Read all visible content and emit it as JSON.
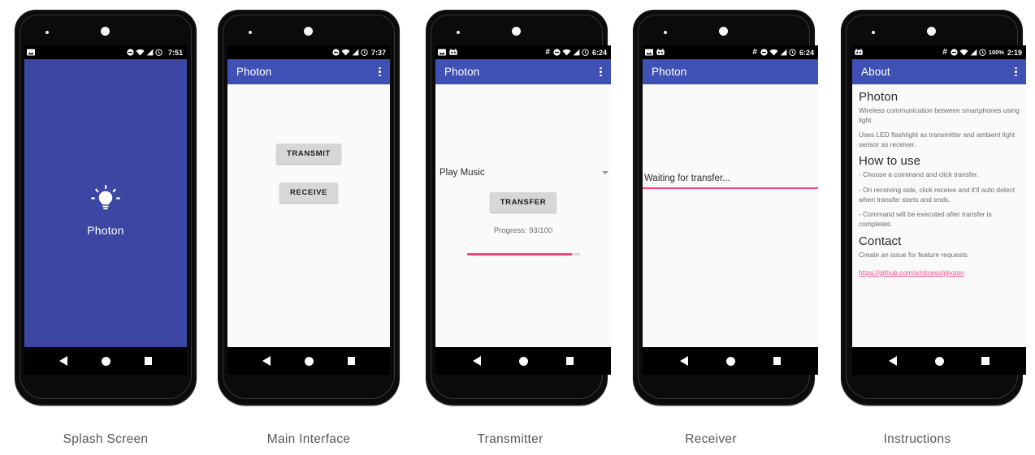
{
  "meta": {
    "app_name": "Photon",
    "accent_blue": "#3f51b5",
    "splash_blue": "#3c46a3",
    "accent_pink": "#ff4081",
    "link_pink": "#ff4d8d"
  },
  "screens": [
    {
      "caption": "Splash Screen",
      "status": {
        "time": "7:51",
        "battery": "",
        "hash": false,
        "android_icon": false,
        "image_icon": true
      },
      "appbar": null,
      "splash": {
        "logo_icon": "lightbulb-icon",
        "app_name": "Photon"
      }
    },
    {
      "caption": "Main Interface",
      "status": {
        "time": "7:37",
        "battery": "",
        "hash": false,
        "android_icon": false,
        "image_icon": true
      },
      "appbar": {
        "title": "Photon",
        "overflow_icon": "overflow-menu-icon"
      },
      "buttons": [
        {
          "label": "TRANSMIT",
          "name": "transmit-button"
        },
        {
          "label": "RECEIVE",
          "name": "receive-button"
        }
      ]
    },
    {
      "caption": "Transmitter",
      "status": {
        "time": "6:24",
        "battery": "",
        "hash": true,
        "android_icon": true,
        "image_icon": true
      },
      "appbar": {
        "title": "Photon",
        "overflow_icon": "overflow-menu-icon"
      },
      "spinner": {
        "selected": "Play Music",
        "caret_icon": "chevron-down-icon"
      },
      "transfer_button": "TRANSFER",
      "progress_text": "Progress: 93/100",
      "progress": {
        "value": 93,
        "max": 100,
        "percent": 93
      }
    },
    {
      "caption": "Receiver",
      "status": {
        "time": "6:24",
        "battery": "",
        "hash": true,
        "android_icon": true,
        "image_icon": true
      },
      "appbar": {
        "title": "Photon",
        "overflow_icon": null
      },
      "status_text": "Waiting for transfer..."
    },
    {
      "caption": "Instructions",
      "status": {
        "time": "2:19",
        "battery": "100%",
        "hash": true,
        "android_icon": true,
        "image_icon": false
      },
      "appbar": {
        "title": "About",
        "overflow_icon": "overflow-menu-icon"
      },
      "about": {
        "heading_app": "Photon",
        "para_1": "Wireless communication between smartphones using light.",
        "para_2": "Uses LED flashlight as transmitter and ambient light sensor as receiver.",
        "heading_howto": "How to use",
        "howto_1": "- Choose a command and click transfer.",
        "howto_2": "- On receiving side, click receive and it’ll auto detect when transfer starts and ends.",
        "howto_3": "- Command will be executed after transfer is completed.",
        "heading_contact": "Contact",
        "contact_text": "Create an issue for feature requests.",
        "contact_link": "https://github.com/amitness/photon"
      }
    }
  ],
  "navbar": {
    "back_icon": "back-triangle-icon",
    "home_icon": "home-circle-icon",
    "recents_icon": "recents-square-icon"
  }
}
